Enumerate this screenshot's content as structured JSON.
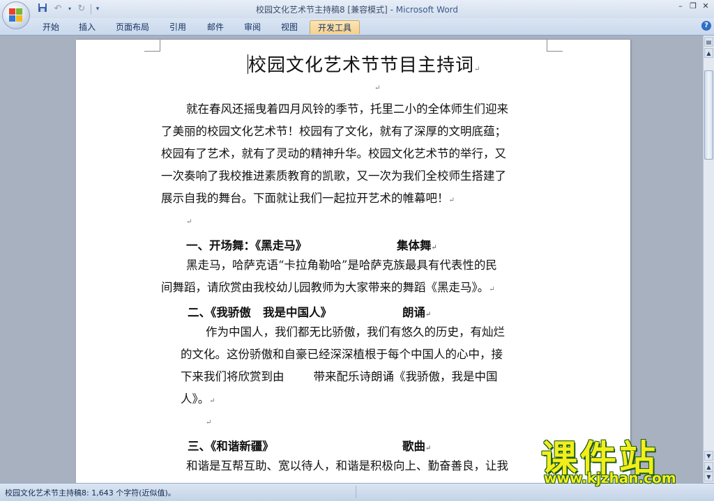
{
  "window": {
    "title": "校园文化艺术节主持稿8 [兼容模式]",
    "separator": " - ",
    "app_name": "Microsoft Word"
  },
  "quick_access": [
    "save-icon",
    "undo-icon",
    "redo-icon",
    "customize-icon"
  ],
  "ribbon": {
    "tabs": [
      "开始",
      "插入",
      "页面布局",
      "引用",
      "邮件",
      "审阅",
      "视图",
      "开发工具"
    ],
    "active_tab": "开发工具"
  },
  "document": {
    "title": "校园文化艺术节节目主持词",
    "intro_lines": [
      "就在春风还摇曳着四月风铃的季节，托里二小的全体师生们迎来",
      "了美丽的校园文化艺术节！校园有了文化，就有了深厚的文明底蕴；",
      "校园有了艺术，就有了灵动的精神升华。校园文化艺术节的举行，又",
      "一次奏响了我校推进素质教育的凯歌，又一次为我们全校师生搭建了",
      "展示自我的舞台。下面就让我们一起拉开艺术的帷幕吧！"
    ],
    "section1": {
      "heading": "一、开场舞：《黑走马》",
      "type": "集体舞",
      "lines": [
        "黑走马，哈萨克语“卡拉角勒哈”是哈萨克族最具有代表性的民",
        "间舞蹈，请欣赏由我校幼儿园教师为大家带来的舞蹈《黑走马》。"
      ]
    },
    "section2": {
      "heading": "二、《我骄傲   我是中国人》",
      "type": "朗诵",
      "lines": [
        "作为中国人，我们都无比骄傲，我们有悠久的历史，有灿烂",
        "的文化。这份骄傲和自豪已经深深植根于每个中国人的心中，接",
        "下来我们将欣赏到由        带来配乐诗朗诵《我骄傲，我是中国",
        "人》。"
      ]
    },
    "section3": {
      "heading": "三、《和谐新疆》",
      "type": "歌曲",
      "lines": [
        "和谐是互帮互助、宽以待人，和谐是积极向上、勤奋善良，让我"
      ]
    },
    "paragraph_mark": "↵"
  },
  "status_bar": {
    "text": "校园文化艺术节主持稿8: 1,643 个字符(近似值)。"
  },
  "watermark": {
    "main": "课件站",
    "url": "www.kjzhan.com"
  }
}
